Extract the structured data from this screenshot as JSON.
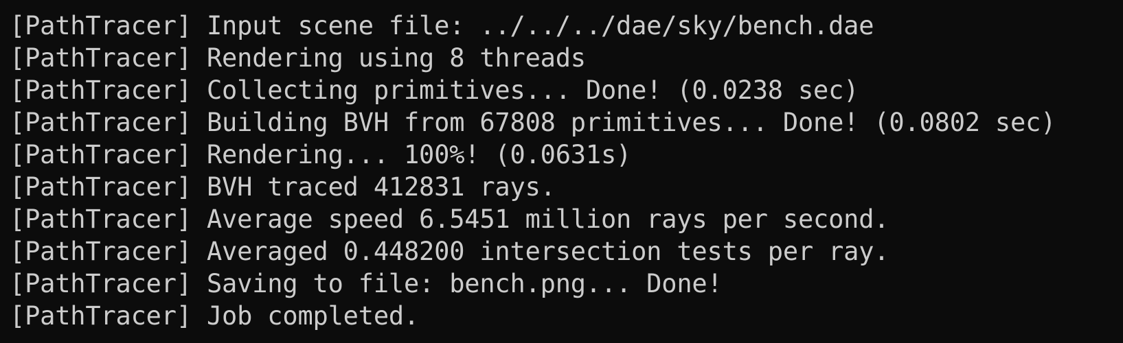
{
  "terminal": {
    "lines": [
      "[PathTracer] Input scene file: ../../../dae/sky/bench.dae",
      "[PathTracer] Rendering using 8 threads",
      "[PathTracer] Collecting primitives... Done! (0.0238 sec)",
      "[PathTracer] Building BVH from 67808 primitives... Done! (0.0802 sec)",
      "[PathTracer] Rendering... 100%! (0.0631s)",
      "[PathTracer] BVH traced 412831 rays.",
      "[PathTracer] Average speed 6.5451 million rays per second.",
      "[PathTracer] Averaged 0.448200 intersection tests per ray.",
      "[PathTracer] Saving to file: bench.png... Done!",
      "[PathTracer] Job completed."
    ]
  },
  "colors": {
    "background": "#0c0c0c",
    "text": "#cccccc"
  }
}
